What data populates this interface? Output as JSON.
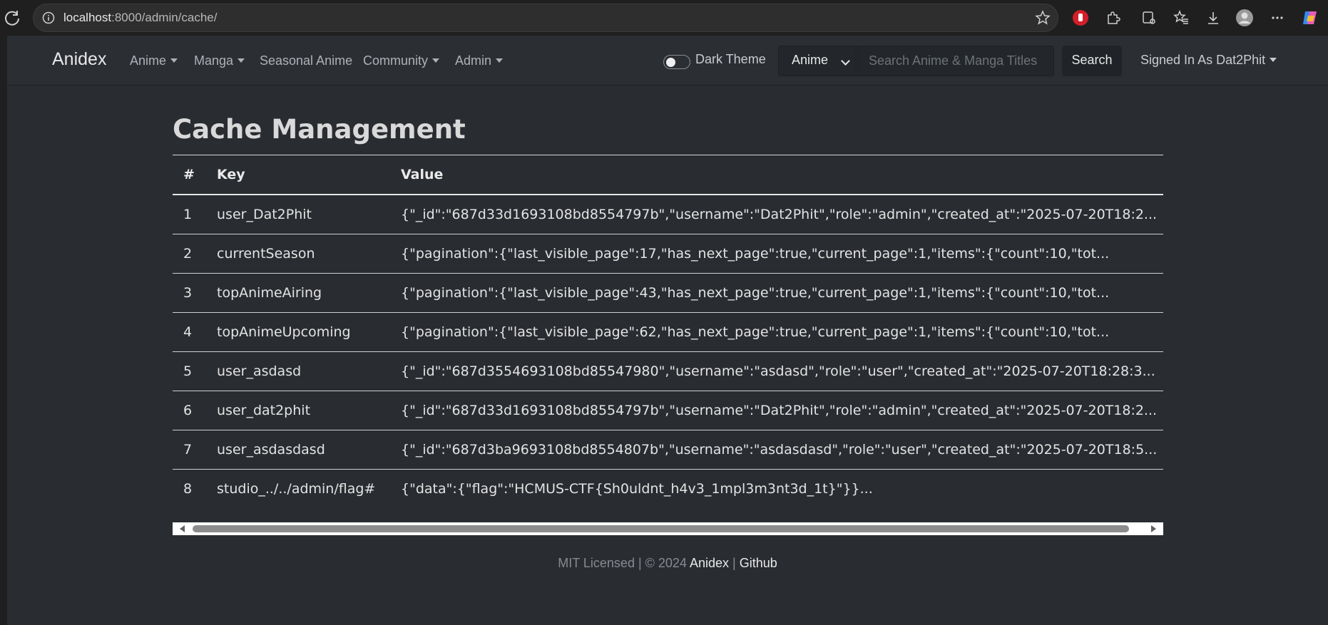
{
  "browser": {
    "url_host": "localhost",
    "url_rest": ":8000/admin/cache/",
    "extension_icons": [
      "reload-icon",
      "site-info-icon",
      "bookmark-star-icon",
      "adblock-icon",
      "extensions-icon",
      "reading-list-icon",
      "favorites-icon",
      "downloads-icon",
      "profile-avatar-icon",
      "more-options-icon",
      "copilot-icon"
    ]
  },
  "navbar": {
    "brand": "Anidex",
    "items": [
      {
        "label": "Anime",
        "dropdown": true
      },
      {
        "label": "Manga",
        "dropdown": true
      },
      {
        "label": "Seasonal Anime",
        "dropdown": false
      },
      {
        "label": "Community",
        "dropdown": true
      },
      {
        "label": "Admin",
        "dropdown": true
      }
    ],
    "theme_toggle_label": "Dark Theme",
    "search_type_selected": "Anime",
    "search_placeholder": "Search Anime & Manga Titles",
    "search_button": "Search",
    "user_menu": "Signed In As Dat2Phit"
  },
  "main": {
    "title": "Cache Management",
    "table": {
      "headers": [
        "#",
        "Key",
        "Value"
      ],
      "rows": [
        {
          "n": "1",
          "key": "user_Dat2Phit",
          "value": "{\"_id\":\"687d33d1693108bd8554797b\",\"username\":\"Dat2Phit\",\"role\":\"admin\",\"created_at\":\"2025-07-20T18:2..."
        },
        {
          "n": "2",
          "key": "currentSeason",
          "value": "{\"pagination\":{\"last_visible_page\":17,\"has_next_page\":true,\"current_page\":1,\"items\":{\"count\":10,\"tot..."
        },
        {
          "n": "3",
          "key": "topAnimeAiring",
          "value": "{\"pagination\":{\"last_visible_page\":43,\"has_next_page\":true,\"current_page\":1,\"items\":{\"count\":10,\"tot..."
        },
        {
          "n": "4",
          "key": "topAnimeUpcoming",
          "value": "{\"pagination\":{\"last_visible_page\":62,\"has_next_page\":true,\"current_page\":1,\"items\":{\"count\":10,\"tot..."
        },
        {
          "n": "5",
          "key": "user_asdasd",
          "value": "{\"_id\":\"687d3554693108bd85547980\",\"username\":\"asdasd\",\"role\":\"user\",\"created_at\":\"2025-07-20T18:28:3..."
        },
        {
          "n": "6",
          "key": "user_dat2phit",
          "value": "{\"_id\":\"687d33d1693108bd8554797b\",\"username\":\"Dat2Phit\",\"role\":\"admin\",\"created_at\":\"2025-07-20T18:2..."
        },
        {
          "n": "7",
          "key": "user_asdasdasd",
          "value": "{\"_id\":\"687d3ba9693108bd8554807b\",\"username\":\"asdasdasd\",\"role\":\"user\",\"created_at\":\"2025-07-20T18:5..."
        },
        {
          "n": "8",
          "key": "studio_../../admin/flag#",
          "value": "{\"data\":{\"flag\":\"HCMUS-CTF{Sh0uldnt_h4v3_1mpl3m3nt3d_1t}\"}}..."
        }
      ]
    }
  },
  "footer": {
    "prefix": "MIT Licensed | © 2024",
    "brand_link": "Anidex",
    "separator": "|",
    "github_link": "Github"
  },
  "colors": {
    "page_bg": "#292c31",
    "navbar_bg": "#2b2e33",
    "browser_bg": "#1f1f1f"
  }
}
